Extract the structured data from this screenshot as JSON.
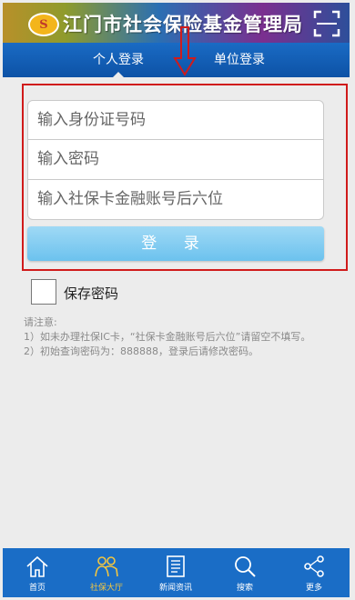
{
  "header": {
    "title": "江门市社会保险基金管理局",
    "logo_text": "S"
  },
  "tabs": [
    {
      "label": "个人登录",
      "active": true
    },
    {
      "label": "单位登录",
      "active": false
    }
  ],
  "form": {
    "id_placeholder": "输入身份证号码",
    "password_placeholder": "输入密码",
    "card_placeholder": "输入社保卡金融账号后六位",
    "login_label": "登 录"
  },
  "remember": {
    "label": "保存密码"
  },
  "notes": {
    "title": "请注意:",
    "line1": "1）如未办理社保IC卡，“社保卡金融账号后六位”请留空不填写。",
    "line2": "2）初始查询密码为：888888，登录后请修改密码。"
  },
  "bottom_nav": [
    {
      "label": "首页",
      "icon": "home-icon"
    },
    {
      "label": "社保大厅",
      "icon": "people-icon",
      "active": true
    },
    {
      "label": "新闻资讯",
      "icon": "news-icon"
    },
    {
      "label": "搜索",
      "icon": "search-icon"
    },
    {
      "label": "更多",
      "icon": "share-icon"
    }
  ],
  "colors": {
    "nav_blue": "#1a6dc6",
    "accent_yellow": "#f3c640",
    "button_blue": "#6cc2ee",
    "annotation_red": "#d01b1b"
  }
}
